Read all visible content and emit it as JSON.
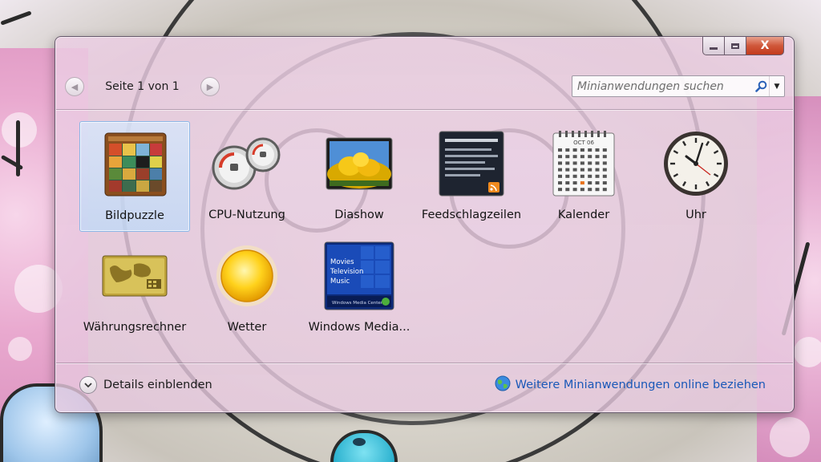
{
  "toolbar": {
    "pager_text": "Seite 1 von 1",
    "prev_glyph": "◀",
    "next_glyph": "▶",
    "search_placeholder": "Minianwendungen suchen",
    "dropdown_glyph": "▼"
  },
  "window_controls": {
    "close_glyph": "X"
  },
  "gadgets": [
    {
      "label": "Bildpuzzle",
      "icon": "picture-puzzle-icon",
      "selected": true
    },
    {
      "label": "CPU-Nutzung",
      "icon": "cpu-meter-icon",
      "selected": false
    },
    {
      "label": "Diashow",
      "icon": "slideshow-icon",
      "selected": false
    },
    {
      "label": "Feedschlagzeilen",
      "icon": "feed-headlines-icon",
      "selected": false
    },
    {
      "label": "Kalender",
      "icon": "calendar-icon",
      "selected": false,
      "month": "OCT 06",
      "highlight_day": "25"
    },
    {
      "label": "Uhr",
      "icon": "clock-icon",
      "selected": false
    },
    {
      "label": "Währungsrechner",
      "icon": "currency-icon",
      "selected": false
    },
    {
      "label": "Wetter",
      "icon": "weather-sun-icon",
      "selected": false
    },
    {
      "label": "Windows Media...",
      "icon": "media-center-icon",
      "selected": false,
      "menu": [
        "Movies",
        "Television",
        "Music"
      ],
      "brand": "Windows Media Center"
    }
  ],
  "footer": {
    "details_label": "Details einblenden",
    "online_label": "Weitere Minianwendungen online beziehen"
  },
  "colors": {
    "window_tint": "#ecd0e4",
    "selection": "#cfe4fb",
    "link": "#1a58b8",
    "close_button": "#c9401f"
  }
}
